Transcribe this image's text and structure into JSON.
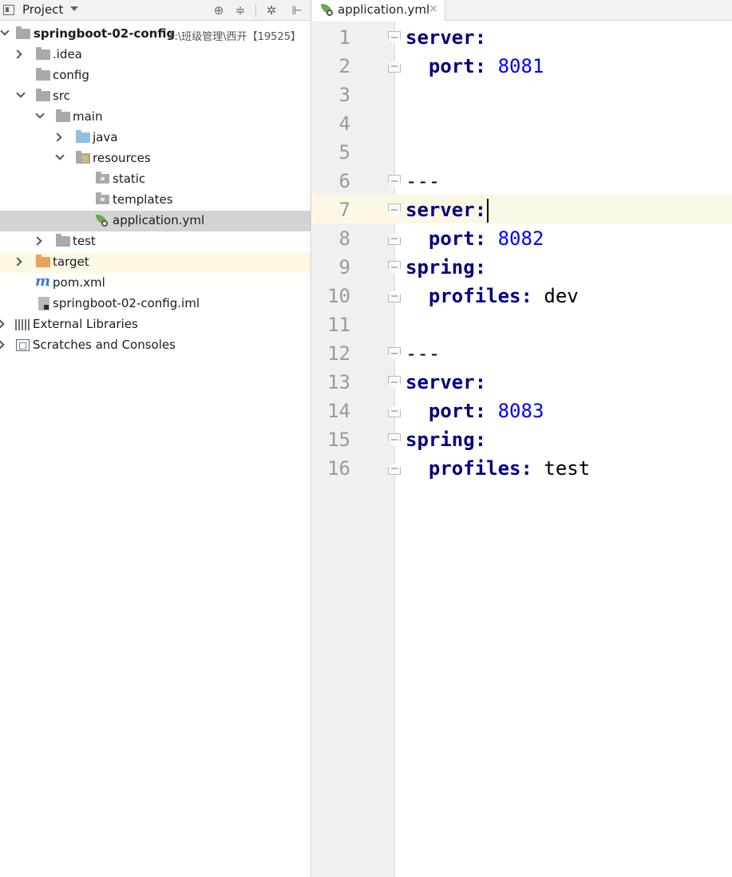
{
  "project_panel": {
    "title": "Project",
    "tree": [
      {
        "label": "springboot-02-config",
        "path": "F:\\班级管理\\西开【19525】",
        "bold": true
      },
      {
        "label": ".idea"
      },
      {
        "label": "config"
      },
      {
        "label": "src"
      },
      {
        "label": "main"
      },
      {
        "label": "java"
      },
      {
        "label": "resources"
      },
      {
        "label": "static"
      },
      {
        "label": "templates"
      },
      {
        "label": "application.yml",
        "selected": true
      },
      {
        "label": "test"
      },
      {
        "label": "target"
      },
      {
        "label": "pom.xml"
      },
      {
        "label": "springboot-02-config.iml"
      },
      {
        "label": "External Libraries"
      },
      {
        "label": "Scratches and Consoles"
      }
    ]
  },
  "editor": {
    "tab_label": "application.yml",
    "tab_close": "×",
    "current_line": 7,
    "line_numbers": [
      "1",
      "2",
      "3",
      "4",
      "5",
      "6",
      "7",
      "8",
      "9",
      "10",
      "11",
      "12",
      "13",
      "14",
      "15",
      "16"
    ],
    "lines": [
      {
        "key": "server",
        "punc": ":",
        "value": ""
      },
      {
        "indent": "  ",
        "key": "port",
        "punc": ": ",
        "value": "8081",
        "value_type": "number"
      },
      {},
      {},
      {},
      {
        "plain": "---"
      },
      {
        "key": "server",
        "punc": ":",
        "value": ""
      },
      {
        "indent": "  ",
        "key": "port",
        "punc": ": ",
        "value": "8082",
        "value_type": "number"
      },
      {
        "key": "spring",
        "punc": ":",
        "value": ""
      },
      {
        "indent": "  ",
        "key": "profiles",
        "punc": ": ",
        "value": "dev",
        "value_type": "plain"
      },
      {},
      {
        "plain": "---"
      },
      {
        "key": "server",
        "punc": ":",
        "value": ""
      },
      {
        "indent": "  ",
        "key": "port",
        "punc": ": ",
        "value": "8083",
        "value_type": "number"
      },
      {
        "key": "spring",
        "punc": ":",
        "value": ""
      },
      {
        "indent": "  ",
        "key": "profiles",
        "punc": ": ",
        "value": "test",
        "value_type": "plain"
      }
    ]
  },
  "colors": {
    "yaml_key": "#000080",
    "yaml_number": "#0000ff",
    "current_line_bg": "#fcf7e5",
    "selected_row_bg": "#d4d4d4",
    "excluded_row_bg": "#fdf8e4"
  }
}
